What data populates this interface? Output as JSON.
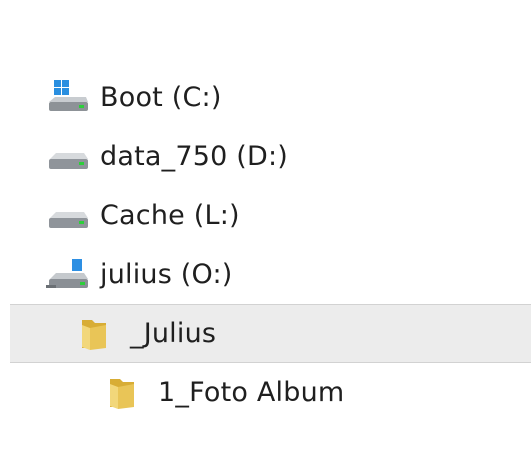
{
  "tree": {
    "items": [
      {
        "label": "Boot (C:)",
        "icon": "system-drive-icon",
        "level": 0,
        "selected": false
      },
      {
        "label": "data_750 (D:)",
        "icon": "hard-drive-icon",
        "level": 0,
        "selected": false
      },
      {
        "label": "Cache (L:)",
        "icon": "hard-drive-icon",
        "level": 0,
        "selected": false
      },
      {
        "label": "julius (O:)",
        "icon": "network-drive-icon",
        "level": 0,
        "selected": false
      },
      {
        "label": "_Julius",
        "icon": "folder-icon",
        "level": 1,
        "selected": true
      },
      {
        "label": "1_Foto Album",
        "icon": "folder-icon",
        "level": 2,
        "selected": false
      }
    ]
  },
  "colors": {
    "selection_bg": "#ececec",
    "selection_border": "#d2d2d2",
    "folder_yellow": "#e8c85a",
    "windows_blue": "#1e90e6"
  }
}
